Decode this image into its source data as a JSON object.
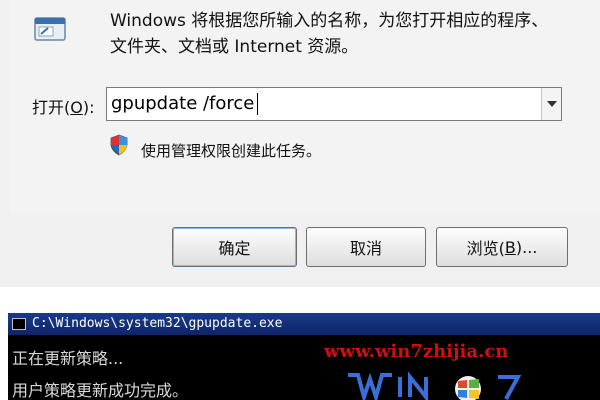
{
  "run_dialog": {
    "description_line1": "Windows 将根据您所输入的名称，为您打开相应的程序、",
    "description_line2": "文件夹、文档或 Internet 资源。",
    "open_label_prefix": "打开(",
    "open_label_hotkey": "O",
    "open_label_suffix": "):",
    "command_value": "gpupdate /force",
    "admin_note": "使用管理权限创建此任务。",
    "ok_label": "确定",
    "cancel_label": "取消",
    "browse_label_prefix": "浏览(",
    "browse_label_hotkey": "B",
    "browse_label_suffix": ")...",
    "icons": [
      "run-app-icon",
      "uac-shield-icon",
      "chevron-down-icon"
    ]
  },
  "console": {
    "title": "C:\\Windows\\system32\\gpupdate.exe",
    "lines": [
      "正在更新策略...",
      "用户策略更新成功完成。"
    ],
    "watermark_url": "www.win7zhijia.cn",
    "colors": {
      "background": "#000000",
      "titlebar": "#1a3a8a",
      "watermark": "#d01010"
    }
  }
}
